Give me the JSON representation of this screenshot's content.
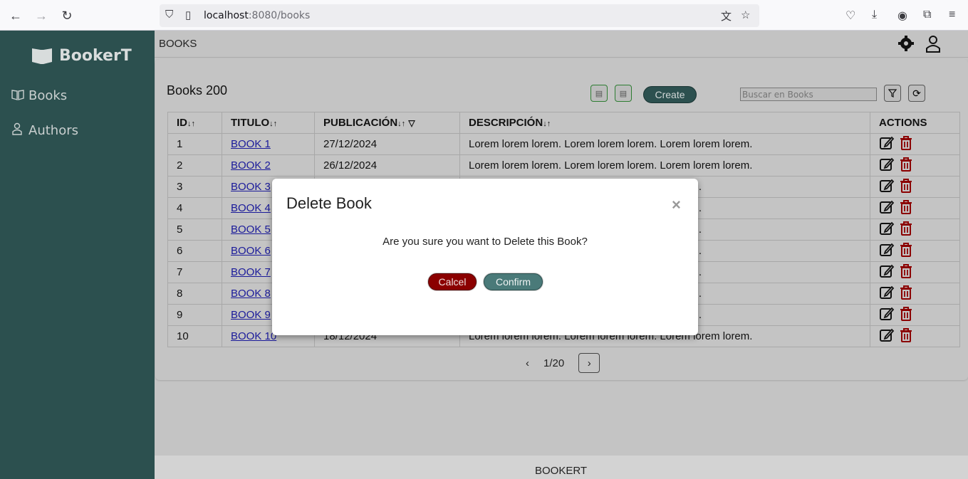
{
  "browser": {
    "url_host": "localhost",
    "url_path": ":8080/books"
  },
  "sidebar": {
    "brand": "BookerT",
    "items": [
      {
        "label": "Books",
        "icon": "book-open-icon"
      },
      {
        "label": "Authors",
        "icon": "user-icon"
      }
    ]
  },
  "topbar": {
    "title": "BOOKS"
  },
  "card": {
    "title": "Books 200",
    "create_label": "Create",
    "search_placeholder": "Buscar en Books"
  },
  "table": {
    "headers": [
      "ID",
      "TITULO",
      "PUBLICACIÓN",
      "DESCRIPCIÓN",
      "ACTIONS"
    ],
    "rows": [
      {
        "id": "1",
        "title": "BOOK 1",
        "date": "27/12/2024",
        "desc": "Lorem lorem lorem. Lorem lorem lorem. Lorem lorem lorem."
      },
      {
        "id": "2",
        "title": "BOOK 2",
        "date": "26/12/2024",
        "desc": "Lorem lorem lorem. Lorem lorem lorem. Lorem lorem lorem."
      },
      {
        "id": "3",
        "title": "BOOK 3",
        "date": "",
        "desc": "rem lorem."
      },
      {
        "id": "4",
        "title": "BOOK 4",
        "date": "",
        "desc": "rem lorem."
      },
      {
        "id": "5",
        "title": "BOOK 5",
        "date": "",
        "desc": "rem lorem."
      },
      {
        "id": "6",
        "title": "BOOK 6",
        "date": "",
        "desc": "rem lorem."
      },
      {
        "id": "7",
        "title": "BOOK 7",
        "date": "",
        "desc": "rem lorem."
      },
      {
        "id": "8",
        "title": "BOOK 8",
        "date": "",
        "desc": "rem lorem."
      },
      {
        "id": "9",
        "title": "BOOK 9",
        "date": "",
        "desc": "rem lorem."
      },
      {
        "id": "10",
        "title": "BOOK 10",
        "date": "18/12/2024",
        "desc": "Lorem lorem lorem. Lorem lorem lorem. Lorem lorem lorem."
      }
    ]
  },
  "pager": {
    "label": "1/20"
  },
  "footer": {
    "text": "BOOKERT"
  },
  "modal": {
    "title": "Delete Book",
    "close": "×",
    "message": "Are you sure you want to Delete this Book?",
    "cancel_label": "Calcel",
    "confirm_label": "Confirm"
  },
  "colors": {
    "sidebar": "#2c504f",
    "cancel": "#8b0000",
    "confirm": "#4a7a79"
  }
}
